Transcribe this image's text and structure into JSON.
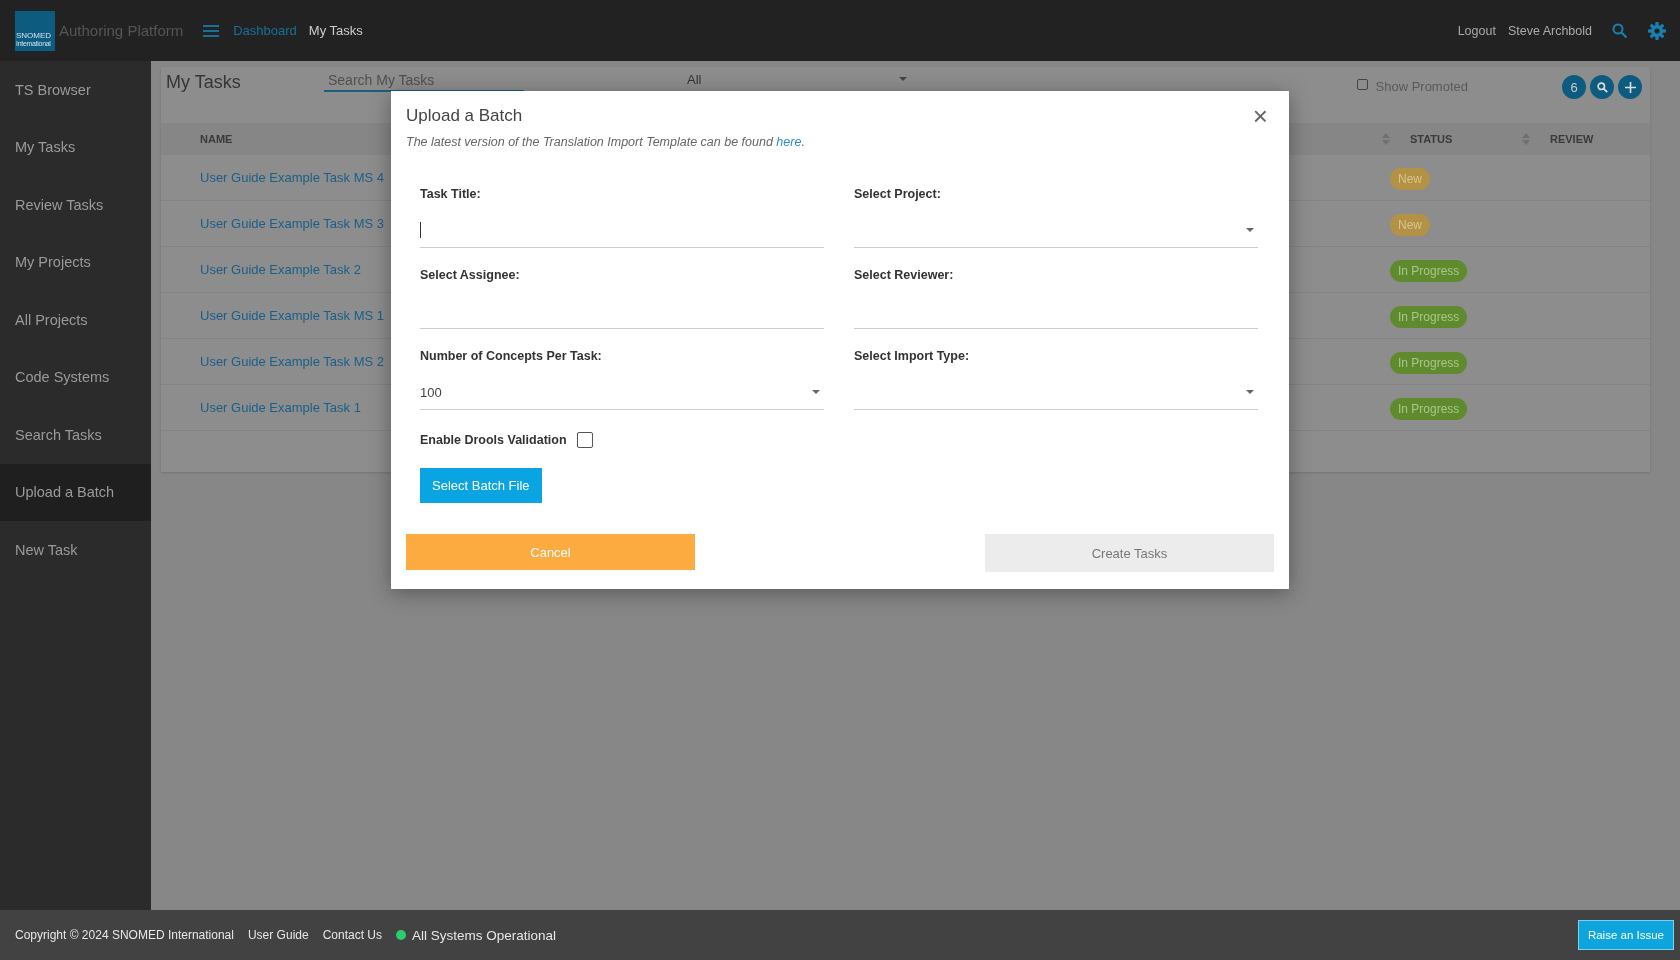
{
  "header": {
    "logo": {
      "line_1": "SNOMED",
      "line_2": "International"
    },
    "app_title": "Authoring Platform",
    "breadcrumbs": [
      {
        "label": "Dashboard",
        "selected": false
      },
      {
        "label": "My Tasks",
        "selected": true
      }
    ],
    "logout": "Logout",
    "user": "Steve Archbold"
  },
  "sidebar": {
    "items": [
      {
        "label": "TS Browser",
        "selected": false
      },
      {
        "label": "My Tasks",
        "selected": false
      },
      {
        "label": "Review Tasks",
        "selected": false
      },
      {
        "label": "My Projects",
        "selected": false
      },
      {
        "label": "All Projects",
        "selected": false
      },
      {
        "label": "Code Systems",
        "selected": false
      },
      {
        "label": "Search Tasks",
        "selected": false
      },
      {
        "label": "Upload a Batch",
        "selected": true
      },
      {
        "label": "New Task",
        "selected": false
      }
    ]
  },
  "tasks_panel": {
    "title": "My Tasks",
    "search": {
      "placeholder": "Search My Tasks"
    },
    "filter": {
      "value": "All"
    },
    "show_promoted": {
      "label": "Show Promoted",
      "checked": false
    },
    "count": "6",
    "table": {
      "columns": [
        "NAME",
        "STATUS",
        "REVIEW"
      ],
      "rows": [
        {
          "name": "User Guide Example Task MS 4",
          "status": {
            "label": "New",
            "kind": "new"
          }
        },
        {
          "name": "User Guide Example Task MS 3",
          "status": {
            "label": "New",
            "kind": "new"
          }
        },
        {
          "name": "User Guide Example Task 2",
          "status": {
            "label": "In Progress",
            "kind": "in_progress"
          }
        },
        {
          "name": "User Guide Example Task MS 1",
          "status": {
            "label": "In Progress",
            "kind": "in_progress"
          }
        },
        {
          "name": "User Guide Example Task MS 2",
          "status": {
            "label": "In Progress",
            "kind": "in_progress"
          }
        },
        {
          "name": "User Guide Example Task 1",
          "status": {
            "label": "In Progress",
            "kind": "in_progress"
          }
        }
      ]
    }
  },
  "modal": {
    "title": "Upload a Batch",
    "close": "×",
    "note": {
      "text": "The latest version of the Translation Import Template can be found ",
      "link": "here",
      "end": "."
    },
    "fields": [
      {
        "label": "Task Title:",
        "kind": "text",
        "focused": true
      },
      {
        "label": "Select Project:",
        "kind": "select",
        "focused": false
      },
      {
        "label": "Select Assignee:",
        "kind": "text",
        "focused": false
      },
      {
        "label": "Select Reviewer:",
        "kind": "text",
        "focused": false
      },
      {
        "label": "Number of Concepts Per Task:",
        "kind": "select",
        "value": "100",
        "focused": false
      },
      {
        "label": "Select Import Type:",
        "kind": "select",
        "focused": false
      }
    ],
    "drools": {
      "label": "Enable Drools Validation",
      "checked": false
    },
    "select_file": "Select Batch File",
    "cancel": "Cancel",
    "create": {
      "label": "Create Tasks",
      "disabled": true
    }
  },
  "footer": {
    "copyright": "Copyright © 2024 SNOMED International",
    "links": [
      "User Guide",
      "Contact Us"
    ],
    "system_status": {
      "label": "All Systems Operational",
      "color": "#2ecc71"
    },
    "raise_issue": "Raise an Issue"
  }
}
